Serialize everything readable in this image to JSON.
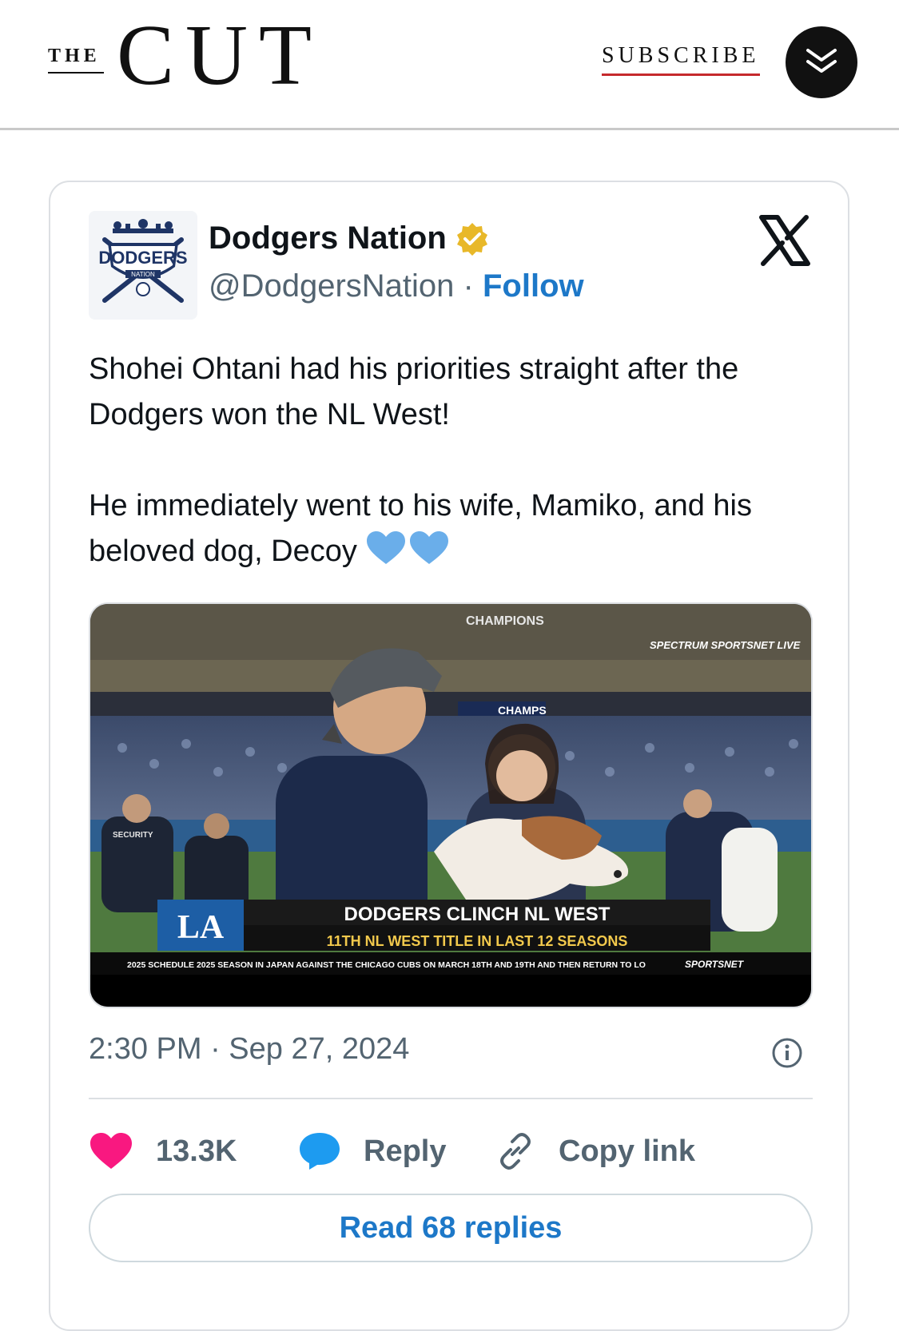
{
  "header": {
    "logo_the": "THE",
    "logo_cut": "CUT",
    "subscribe_label": "SUBSCRIBE",
    "menu_icon": "double-chevron-down-icon"
  },
  "tweet": {
    "author_name": "Dodgers Nation",
    "verified_icon": "verified-badge-icon",
    "handle": "@DodgersNation",
    "separator": " · ",
    "follow_label": "Follow",
    "avatar_text_top": "DODGERS",
    "avatar_text_bottom": "NATION",
    "platform_icon": "x-logo-icon",
    "text_para1": "Shohei Ohtani had his priorities straight after the Dodgers won the NL West!",
    "text_para2": "He immediately went to his wife, Mamiko, and his beloved dog, Decoy",
    "emoji": "blue-heart-icon",
    "media": {
      "network_brand": "SPECTRUM SPORTSNET LIVE",
      "banner_banner_logo": "LA",
      "banner_headline": "DODGERS CLINCH NL WEST",
      "banner_subline": "11TH NL WEST TITLE IN LAST 12 SEASONS",
      "ticker": "2025 SCHEDULE  2025 SEASON IN JAPAN AGAINST THE CHICAGO CUBS ON MARCH 18TH AND 19TH AND THEN RETURN TO LO",
      "ticker_brand": "SPORTSNET",
      "sign_text": "CHAMPIONS",
      "sign_text2": "CHAMPS",
      "security_text": "SECURITY"
    },
    "timestamp": "2:30 PM · Sep 27, 2024",
    "likes_count": "13.3K",
    "reply_label": "Reply",
    "copy_link_label": "Copy link",
    "read_replies_label": "Read 68 replies"
  },
  "colors": {
    "link_blue": "#1d78c8",
    "like_pink": "#f91880",
    "reply_blue": "#1d9bf0",
    "subscribe_underline": "#c5292c",
    "verified_gold": "#e8b829"
  }
}
